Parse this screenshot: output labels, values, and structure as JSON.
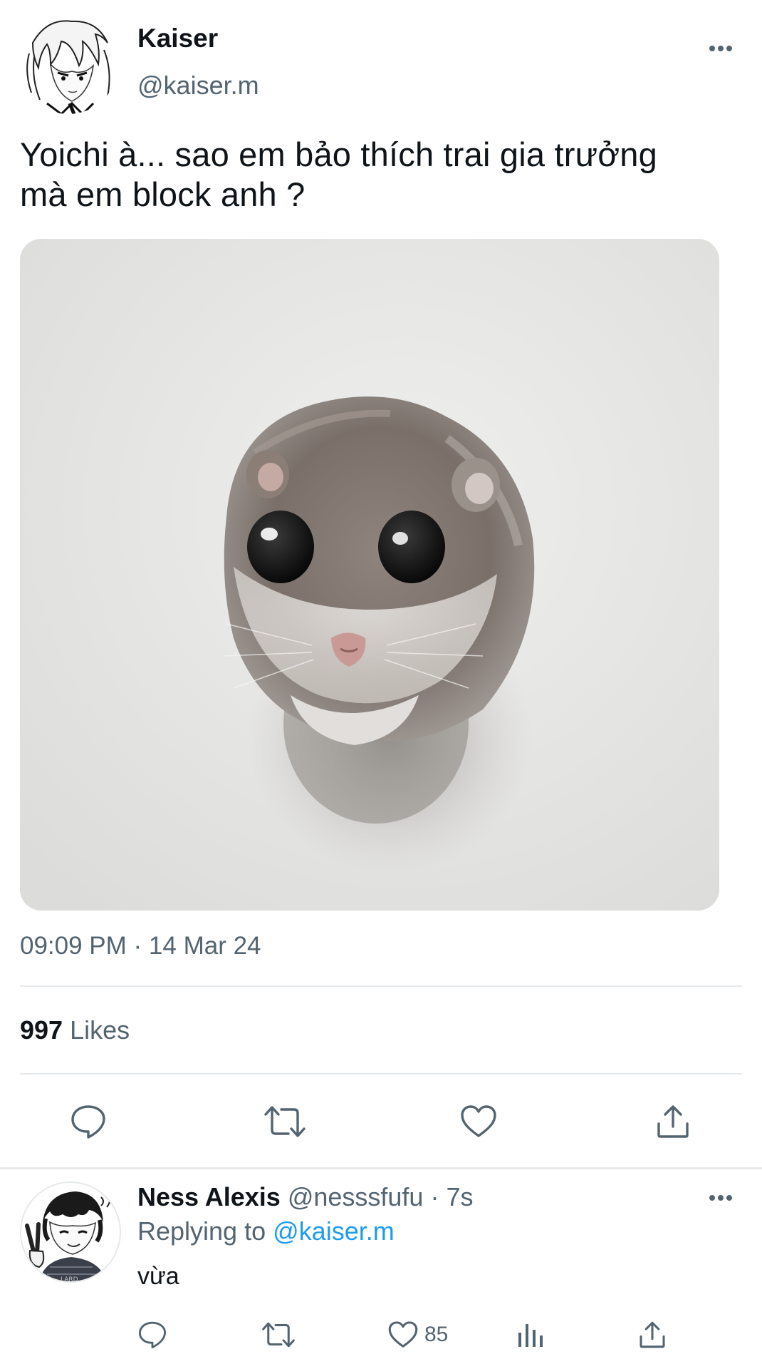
{
  "tweet": {
    "author": {
      "name": "Kaiser",
      "handle": "@kaiser.m",
      "avatar_icon": "manga-avatar-kaiser"
    },
    "text_line1": "Yoichi à... sao em bảo thích trai gia trưởng",
    "text_line2": "mà em block anh ?",
    "media_subject": "hamster-photo",
    "timestamp": "09:09 PM · 14 Mar 24",
    "likes_count": "997",
    "likes_label": "Likes",
    "actions": [
      "reply-icon",
      "retweet-icon",
      "like-icon",
      "share-icon"
    ]
  },
  "reply": {
    "author_name": "Ness Alexis",
    "author_handle": "@nesssfufu",
    "separator": "·",
    "time": "7s",
    "replying_to_label": "Replying to",
    "replying_to_handle": "@kaiser.m",
    "text": "vừa",
    "like_count": "85",
    "avatar_icon": "manga-avatar-ness",
    "actions": [
      "reply-icon",
      "retweet-icon",
      "like-icon",
      "views-icon",
      "share-icon"
    ]
  },
  "colors": {
    "text_primary": "#0f1419",
    "text_secondary": "#536471",
    "link": "#1d9bf0",
    "divider": "#e6e9eb"
  }
}
